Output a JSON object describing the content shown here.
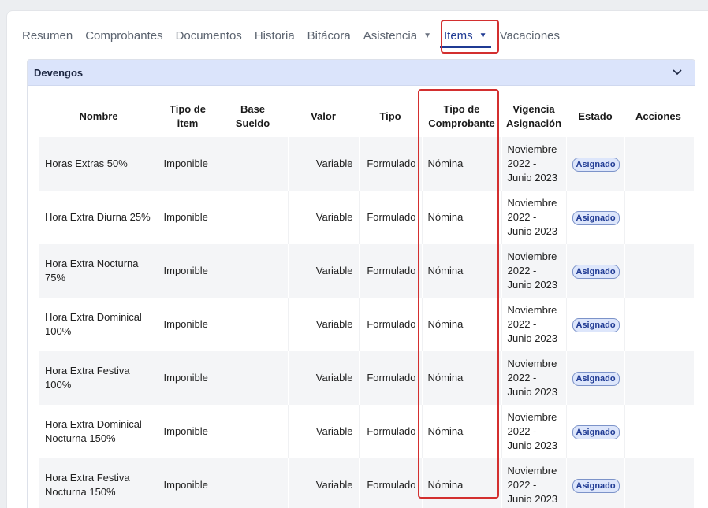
{
  "tabs": [
    {
      "label": "Resumen",
      "caret": false,
      "active": false
    },
    {
      "label": "Comprobantes",
      "caret": false,
      "active": false
    },
    {
      "label": "Documentos",
      "caret": false,
      "active": false
    },
    {
      "label": "Historia",
      "caret": false,
      "active": false
    },
    {
      "label": "Bitácora",
      "caret": false,
      "active": false
    },
    {
      "label": "Asistencia",
      "caret": true,
      "active": false
    },
    {
      "label": "Items",
      "caret": true,
      "active": true
    },
    {
      "label": "Vacaciones",
      "caret": false,
      "active": false
    }
  ],
  "panel": {
    "title": "Devengos"
  },
  "table": {
    "headers": {
      "nombre": "Nombre",
      "tipo_item_1": "Tipo de",
      "tipo_item_2": "item",
      "base_1": "Base",
      "base_2": "Sueldo",
      "valor": "Valor",
      "tipo": "Tipo",
      "comprobante_1": "Tipo de",
      "comprobante_2": "Comprobante",
      "vigencia_1": "Vigencia",
      "vigencia_2": "Asignación",
      "estado": "Estado",
      "acciones": "Acciones"
    },
    "rows": [
      {
        "nombre": "Horas Extras 50%",
        "tipo_item": "Imponible",
        "base_sueldo": "",
        "valor": "Variable",
        "tipo": "Formulado",
        "comprobante": "Nómina",
        "vig_1": "Noviembre",
        "vig_2": "2022 -",
        "vig_3": "Junio 2023",
        "estado": "Asignado"
      },
      {
        "nombre": "Hora Extra Diurna 25%",
        "tipo_item": "Imponible",
        "base_sueldo": "",
        "valor": "Variable",
        "tipo": "Formulado",
        "comprobante": "Nómina",
        "vig_1": "Noviembre",
        "vig_2": "2022 -",
        "vig_3": "Junio 2023",
        "estado": "Asignado"
      },
      {
        "nombre": "Hora Extra Nocturna 75%",
        "tipo_item": "Imponible",
        "base_sueldo": "",
        "valor": "Variable",
        "tipo": "Formulado",
        "comprobante": "Nómina",
        "vig_1": "Noviembre",
        "vig_2": "2022 -",
        "vig_3": "Junio 2023",
        "estado": "Asignado"
      },
      {
        "nombre": "Hora Extra Dominical 100%",
        "tipo_item": "Imponible",
        "base_sueldo": "",
        "valor": "Variable",
        "tipo": "Formulado",
        "comprobante": "Nómina",
        "vig_1": "Noviembre",
        "vig_2": "2022 -",
        "vig_3": "Junio 2023",
        "estado": "Asignado"
      },
      {
        "nombre": "Hora Extra Festiva 100%",
        "tipo_item": "Imponible",
        "base_sueldo": "",
        "valor": "Variable",
        "tipo": "Formulado",
        "comprobante": "Nómina",
        "vig_1": "Noviembre",
        "vig_2": "2022 -",
        "vig_3": "Junio 2023",
        "estado": "Asignado"
      },
      {
        "nombre": "Hora Extra Dominical Nocturna 150%",
        "tipo_item": "Imponible",
        "base_sueldo": "",
        "valor": "Variable",
        "tipo": "Formulado",
        "comprobante": "Nómina",
        "vig_1": "Noviembre",
        "vig_2": "2022 -",
        "vig_3": "Junio 2023",
        "estado": "Asignado"
      },
      {
        "nombre": "Hora Extra Festiva Nocturna 150%",
        "tipo_item": "Imponible",
        "base_sueldo": "",
        "valor": "Variable",
        "tipo": "Formulado",
        "comprobante": "Nómina",
        "vig_1": "Noviembre",
        "vig_2": "2022 -",
        "vig_3": "Junio 2023",
        "estado": "Asignado"
      }
    ]
  },
  "colors": {
    "accent": "#1f3a93",
    "highlight_border": "#d32f2f",
    "panel_header_bg": "#dbe4fb"
  }
}
